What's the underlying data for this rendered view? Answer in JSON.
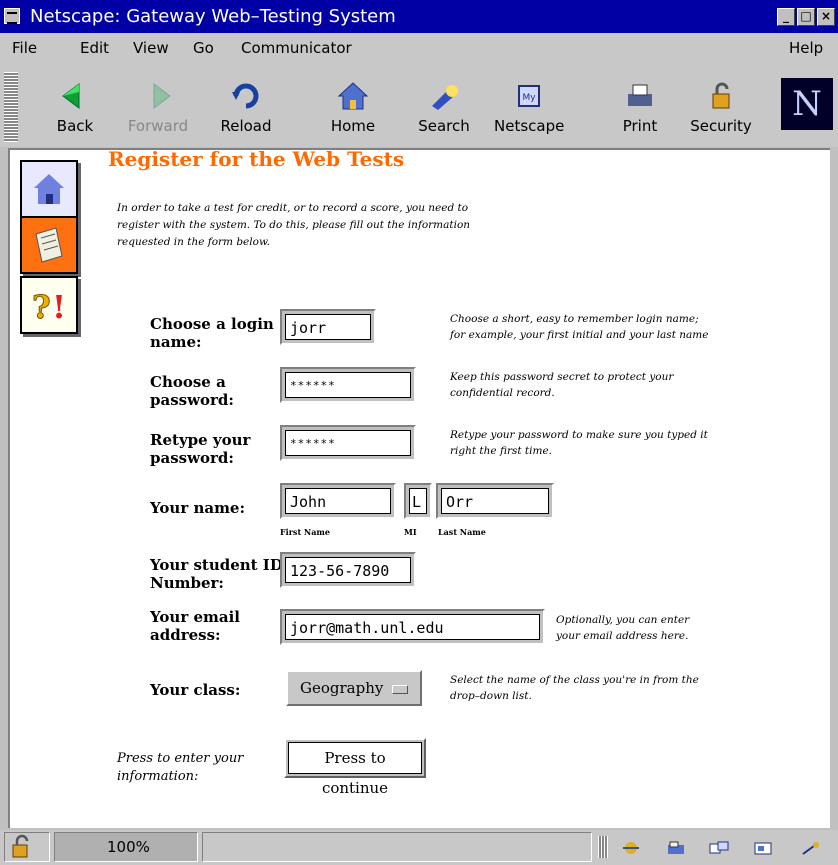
{
  "window": {
    "title": "Netscape: Gateway Web–Testing System"
  },
  "menu": [
    "File",
    "Edit",
    "View",
    "Go",
    "Communicator",
    "Help"
  ],
  "toolbar": {
    "back": "Back",
    "forward": "Forward",
    "reload": "Reload",
    "home": "Home",
    "search": "Search",
    "netscape": "Netscape",
    "print": "Print",
    "security": "Security"
  },
  "page": {
    "heading": "Register for the Web Tests",
    "intro": [
      "In order to take a test for credit, or to record a score, you need to",
      "register with the system. To do this, please fill out the information",
      "requested in the form below."
    ]
  },
  "form": {
    "login": {
      "label": [
        "Choose a login",
        "name:"
      ],
      "value": "jorr",
      "help": [
        "Choose a short, easy to remember login name;",
        "for example, your first initial and your last name"
      ]
    },
    "password": {
      "label": [
        "Choose a",
        "password:"
      ],
      "value": "******",
      "help": [
        "Keep this password secret to protect your",
        "confidential record."
      ]
    },
    "retype": {
      "label": [
        "Retype your",
        "password:"
      ],
      "value": "******",
      "help": [
        "Retype your password to make sure you typed it",
        "right the first time."
      ]
    },
    "name": {
      "label": "Your name:",
      "first": "John",
      "mi": "L",
      "last": "Orr",
      "first_caption": "First Name",
      "mi_caption": "MI",
      "last_caption": "Last Name"
    },
    "student_id": {
      "label": [
        "Your student ID",
        "Number:"
      ],
      "value": "123-56-7890"
    },
    "email": {
      "label": [
        "Your email",
        "address:"
      ],
      "value": "jorr@math.unl.edu",
      "help": [
        "Optionally, you can enter",
        "your email address here."
      ]
    },
    "class": {
      "label": "Your class:",
      "selected": "Geography",
      "help": [
        "Select the name of the class you're in from the",
        "drop–down list."
      ]
    },
    "submit": {
      "prompt": [
        "Press to enter your",
        "information:"
      ],
      "button": "Press to continue"
    }
  },
  "status": {
    "zoom": "100%"
  },
  "icons": {
    "nav": [
      "home-page-icon",
      "notes-page-icon",
      "help-page-icon"
    ]
  }
}
